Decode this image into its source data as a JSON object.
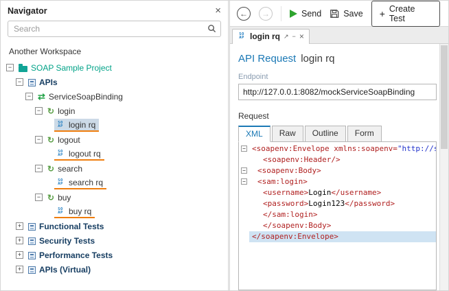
{
  "icons": {
    "close": "×",
    "back": "←",
    "forward": "→",
    "collapse": "−",
    "expand": "+",
    "binding": "⇄",
    "operation": "↻",
    "soap_top": "SO",
    "soap_bottom": "AP",
    "detach": "↗",
    "minimize": "−",
    "tab_close": "×",
    "plus": "+",
    "fold": "−"
  },
  "colors": {
    "accent_blue": "#1a78b5",
    "project_teal": "#00a287",
    "section_navy": "#173e62",
    "underline_orange": "#ef7d0d",
    "selection": "#ccdae7"
  },
  "navigator": {
    "title": "Navigator",
    "search_placeholder": "Search",
    "workspace_label": "Another Workspace",
    "tree": [
      {
        "label": "SOAP Sample Project",
        "level": 0,
        "icon": "folder",
        "expander": "minus",
        "color": "#00a287",
        "bold": false
      },
      {
        "label": "APIs",
        "level": 1,
        "icon": "module",
        "expander": "minus",
        "color": "#173e62",
        "bold": true
      },
      {
        "label": "ServiceSoapBinding",
        "level": 2,
        "icon": "binding",
        "expander": "minus",
        "color": "#333333"
      },
      {
        "label": "login",
        "level": 3,
        "icon": "operation",
        "expander": "minus",
        "color": "#333333"
      },
      {
        "label": "login rq",
        "level": 4,
        "icon": "soap",
        "expander": null,
        "color": "#333333",
        "selected": true,
        "underline": true
      },
      {
        "label": "logout",
        "level": 3,
        "icon": "operation",
        "expander": "minus",
        "color": "#333333"
      },
      {
        "label": "logout rq",
        "level": 4,
        "icon": "soap",
        "expander": null,
        "color": "#333333",
        "underline": true
      },
      {
        "label": "search",
        "level": 3,
        "icon": "operation",
        "expander": "minus",
        "color": "#333333"
      },
      {
        "label": "search rq",
        "level": 4,
        "icon": "soap",
        "expander": null,
        "color": "#333333",
        "underline": true
      },
      {
        "label": "buy",
        "level": 3,
        "icon": "operation",
        "expander": "minus",
        "color": "#333333"
      },
      {
        "label": "buy rq",
        "level": 4,
        "icon": "soap",
        "expander": null,
        "color": "#333333",
        "underline": true
      },
      {
        "label": "Functional Tests",
        "level": 1,
        "icon": "module",
        "expander": "plus",
        "color": "#173e62",
        "bold": true
      },
      {
        "label": "Security Tests",
        "level": 1,
        "icon": "module",
        "expander": "plus",
        "color": "#173e62",
        "bold": true
      },
      {
        "label": "Performance Tests",
        "level": 1,
        "icon": "module",
        "expander": "plus",
        "color": "#173e62",
        "bold": true
      },
      {
        "label": "APIs (Virtual)",
        "level": 1,
        "icon": "module",
        "expander": "plus",
        "color": "#173e62",
        "bold": true
      }
    ]
  },
  "toolbar": {
    "send_label": "Send",
    "save_label": "Save",
    "create_test_label": "Create Test"
  },
  "tab": {
    "label": "login rq"
  },
  "request": {
    "title_prefix": "API Request",
    "title_name": "login rq",
    "endpoint_label": "Endpoint",
    "endpoint_value": "http://127.0.0.1:8082/mockServiceSoapBinding",
    "request_label": "Request",
    "tabs": [
      {
        "label": "XML",
        "active": true
      },
      {
        "label": "Raw",
        "active": false
      },
      {
        "label": "Outline",
        "active": false
      },
      {
        "label": "Form",
        "active": false
      }
    ]
  },
  "editor": {
    "colors": {
      "tag": "#b02020",
      "attr": "#b02020",
      "value": "#2233cc",
      "text": "#000000"
    },
    "highlight_bg": "#cfe3f3",
    "lines": [
      {
        "fold": true,
        "indent": 0,
        "segments": [
          {
            "type": "tag",
            "text": "<soapenv:Envelope"
          },
          {
            "type": "attr",
            "text": " xmlns:soapenv="
          },
          {
            "type": "value",
            "text": "\"http://s"
          }
        ]
      },
      {
        "fold": false,
        "indent": 2,
        "segments": [
          {
            "type": "tag",
            "text": "<soapenv:Header/>"
          }
        ]
      },
      {
        "fold": true,
        "indent": 1,
        "segments": [
          {
            "type": "tag",
            "text": "<soapenv:Body>"
          }
        ]
      },
      {
        "fold": true,
        "indent": 1,
        "segments": [
          {
            "type": "tag",
            "text": "<sam:login>"
          }
        ]
      },
      {
        "fold": false,
        "indent": 2,
        "segments": [
          {
            "type": "tag",
            "text": "<username>"
          },
          {
            "type": "text",
            "text": "Login"
          },
          {
            "type": "tag",
            "text": "</username>"
          }
        ]
      },
      {
        "fold": false,
        "indent": 2,
        "segments": [
          {
            "type": "tag",
            "text": "<password>"
          },
          {
            "type": "text",
            "text": "Login123"
          },
          {
            "type": "tag",
            "text": "</password>"
          }
        ]
      },
      {
        "fold": false,
        "indent": 2,
        "segments": [
          {
            "type": "tag",
            "text": "</sam:login>"
          }
        ]
      },
      {
        "fold": false,
        "indent": 2,
        "segments": [
          {
            "type": "tag",
            "text": "</soapenv:Body>"
          }
        ]
      },
      {
        "fold": false,
        "indent": 0,
        "highlighted": true,
        "segments": [
          {
            "type": "tag",
            "text": "</soapenv:Envelope>"
          }
        ]
      }
    ]
  }
}
